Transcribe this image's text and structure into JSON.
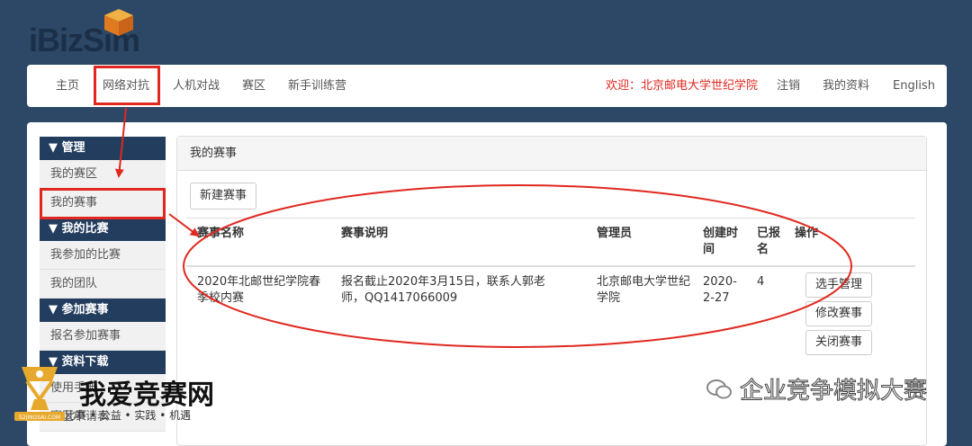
{
  "logo": {
    "text_a": "iBiz",
    "text_b": "Sim"
  },
  "nav": {
    "home": "主页",
    "network": "网络对抗",
    "hvm": "人机对战",
    "zone": "赛区",
    "training": "新手训练营",
    "welcome": "欢迎：北京邮电大学世纪学院",
    "logout": "注销",
    "profile": "我的资料",
    "english": "English"
  },
  "sidebar": {
    "sections": [
      {
        "title": "▼ 管理",
        "items": [
          "我的赛区",
          "我的赛事"
        ]
      },
      {
        "title": "▼ 我的比赛",
        "items": [
          "我参加的比赛",
          "我的团队"
        ]
      },
      {
        "title": "▼ 参加赛事",
        "items": [
          "报名参加赛事"
        ]
      },
      {
        "title": "▼ 资料下载",
        "items": [
          "使用手册",
          "赛区申请表"
        ]
      }
    ]
  },
  "panel": {
    "title": "我的赛事",
    "new_button": "新建赛事",
    "columns": [
      "赛事名称",
      "赛事说明",
      "管理员",
      "创建时间",
      "已报名",
      "操作"
    ],
    "rows": [
      {
        "name": "2020年北邮世纪学院春季校内赛",
        "desc": "报名截止2020年3月15日，联系人郭老师，QQ1417066009",
        "admin": "北京邮电大学世纪学院",
        "created": "2020-2-27",
        "registered": "4",
        "actions": [
          "选手管理",
          "修改赛事",
          "关闭赛事"
        ]
      }
    ]
  },
  "watermark": {
    "left_title": "我爱竞赛网",
    "left_sub": "比赛 • 公益 • 实践 • 机遇",
    "left_badge": "52JINGSAI.COM",
    "right": "企业竞争模拟大赛"
  },
  "colors": {
    "bg": "#2c4866",
    "accent": "#e0281f",
    "sidebar_head": "#233d5e"
  }
}
